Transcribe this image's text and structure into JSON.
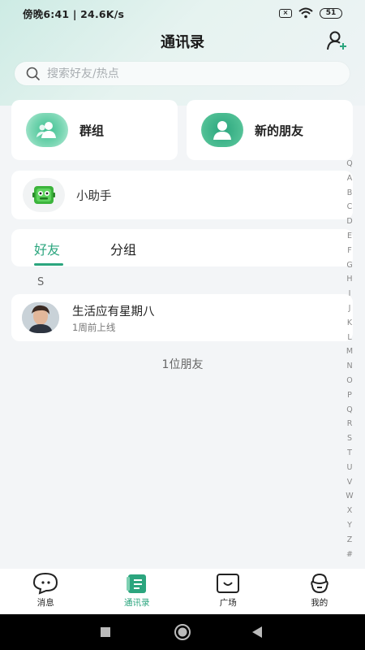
{
  "status_bar": {
    "left_text": "傍晚6:41 | 24.6K/s",
    "sim_icon": "x-box-icon",
    "battery": "51"
  },
  "header": {
    "title": "通讯录",
    "add_icon": "add-user-icon"
  },
  "search": {
    "placeholder": "搜索好友/热点"
  },
  "quick_actions": [
    {
      "label": "群组",
      "icon": "group-icon"
    },
    {
      "label": "新的朋友",
      "icon": "new-friend-icon"
    }
  ],
  "assistant": {
    "label": "小助手",
    "icon": "assistant-robot-icon"
  },
  "tabs": [
    {
      "label": "好友",
      "active": true
    },
    {
      "label": "分组",
      "active": false
    }
  ],
  "section": {
    "letter": "S"
  },
  "friends": [
    {
      "name": "生活应有星期八",
      "status": "1周前上线"
    }
  ],
  "friend_count": "1位朋友",
  "alpha_index": [
    "Q",
    "A",
    "B",
    "C",
    "D",
    "E",
    "F",
    "G",
    "H",
    "I",
    "J",
    "K",
    "L",
    "M",
    "N",
    "O",
    "P",
    "Q",
    "R",
    "S",
    "T",
    "U",
    "V",
    "W",
    "X",
    "Y",
    "Z",
    "#"
  ],
  "bottom_nav": [
    {
      "label": "消息",
      "icon": "chat-bubble-icon",
      "active": false
    },
    {
      "label": "通讯录",
      "icon": "contacts-icon",
      "active": true
    },
    {
      "label": "广场",
      "icon": "square-icon",
      "active": false
    },
    {
      "label": "我的",
      "icon": "profile-icon",
      "active": false
    }
  ],
  "colors": {
    "accent": "#2ba57e",
    "background": "#f3f5f7"
  }
}
